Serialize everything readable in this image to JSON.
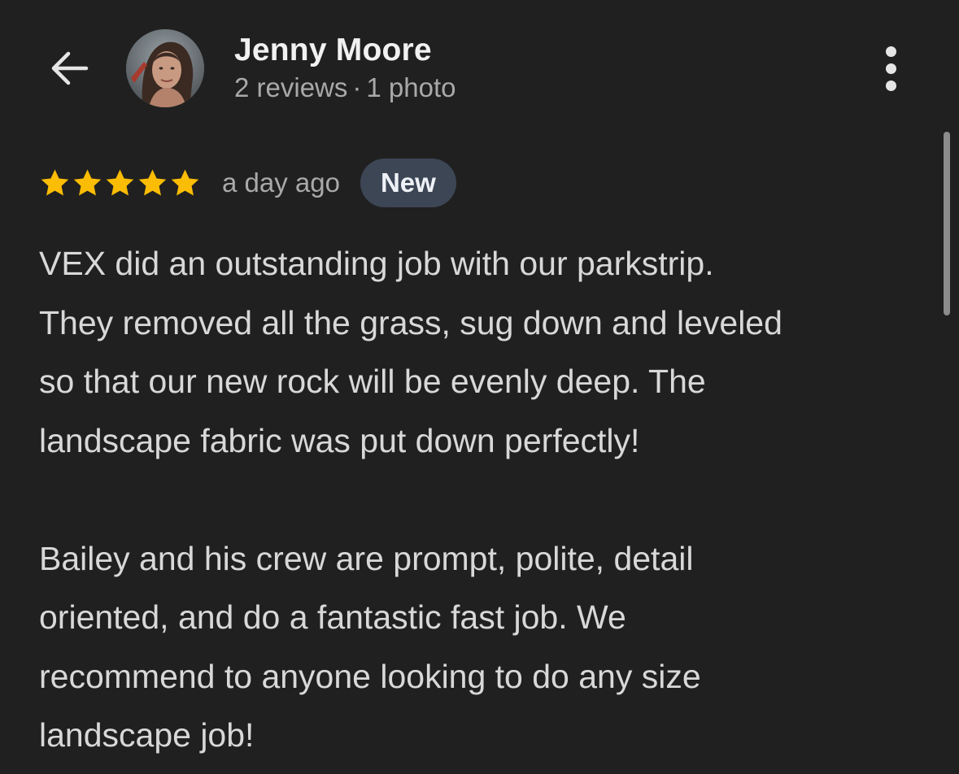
{
  "header": {
    "back_icon": "arrow-left-icon",
    "reviewer_name": "Jenny Moore",
    "reviews_count": "2 reviews",
    "separator": "·",
    "photos_count": "1 photo",
    "more_icon": "more-vertical-icon"
  },
  "review": {
    "rating": 5,
    "rating_max": 5,
    "star_color": "#fbbc04",
    "age": "a day ago",
    "badge": "New",
    "paragraph1_lines": [
      "VEX did an outstanding job with our parkstrip.",
      "They removed all the grass, sug down and leveled",
      "so that our new rock will be evenly deep. The",
      "landscape fabric was put down perfectly!"
    ],
    "paragraph2_lines": [
      "Bailey and his crew are prompt, polite, detail",
      "oriented, and do a fantastic fast job. We",
      "recommend to anyone looking to do any size",
      "landscape job!"
    ]
  },
  "colors": {
    "background": "#202020",
    "badge_background": "#3c4655"
  }
}
